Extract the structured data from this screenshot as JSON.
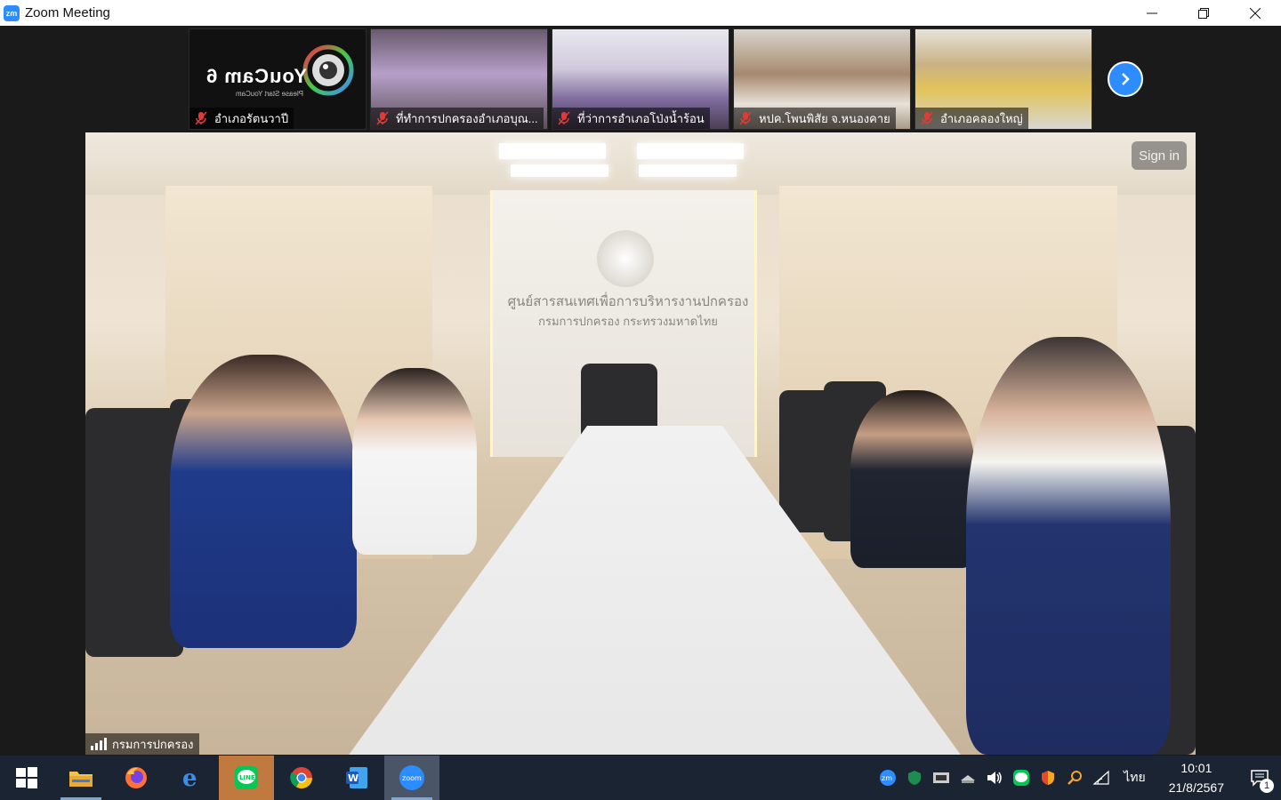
{
  "window": {
    "app_icon": "zm",
    "title": "Zoom Meeting",
    "controls": [
      "minimize-icon",
      "restore-icon",
      "close-icon"
    ]
  },
  "thumbnails": [
    {
      "label": "อำเภอรัตนวาปี",
      "muted": true,
      "logo_text": "YouCam 6",
      "logo_sub": "Please Start YouCam"
    },
    {
      "label": "ที่ทำการปกครองอำเภอบุณ...",
      "muted": true
    },
    {
      "label": "ที่ว่าการอำเภอโป่งน้ำร้อน",
      "muted": true
    },
    {
      "label": "หปค.โพนพิสัย จ.หนองคาย",
      "muted": true
    },
    {
      "label": "อำเภอคลองใหญ่",
      "muted": true
    }
  ],
  "main_video": {
    "sign_in_label": "Sign in",
    "speaker_label": "กรมการปกครอง",
    "wall_text_line1": "ศูนย์สารสนเทศเพื่อการบริหารงานปกครอง",
    "wall_text_line2": "กรมการปกครอง กระทรวงมหาดไทย"
  },
  "taskbar": {
    "apps": [
      {
        "name": "file-explorer-icon",
        "glyph": "📁"
      },
      {
        "name": "firefox-icon",
        "glyph": "🦊"
      },
      {
        "name": "edge-icon",
        "glyph": "e"
      },
      {
        "name": "line-icon",
        "glyph": "LINE"
      },
      {
        "name": "chrome-icon",
        "glyph": "●"
      },
      {
        "name": "word-icon",
        "glyph": "W"
      },
      {
        "name": "zoom-icon",
        "glyph": "zoom"
      }
    ],
    "tray_lang": "ไทย",
    "time": "10:01",
    "date": "21/8/2567",
    "notification_count": "1"
  }
}
